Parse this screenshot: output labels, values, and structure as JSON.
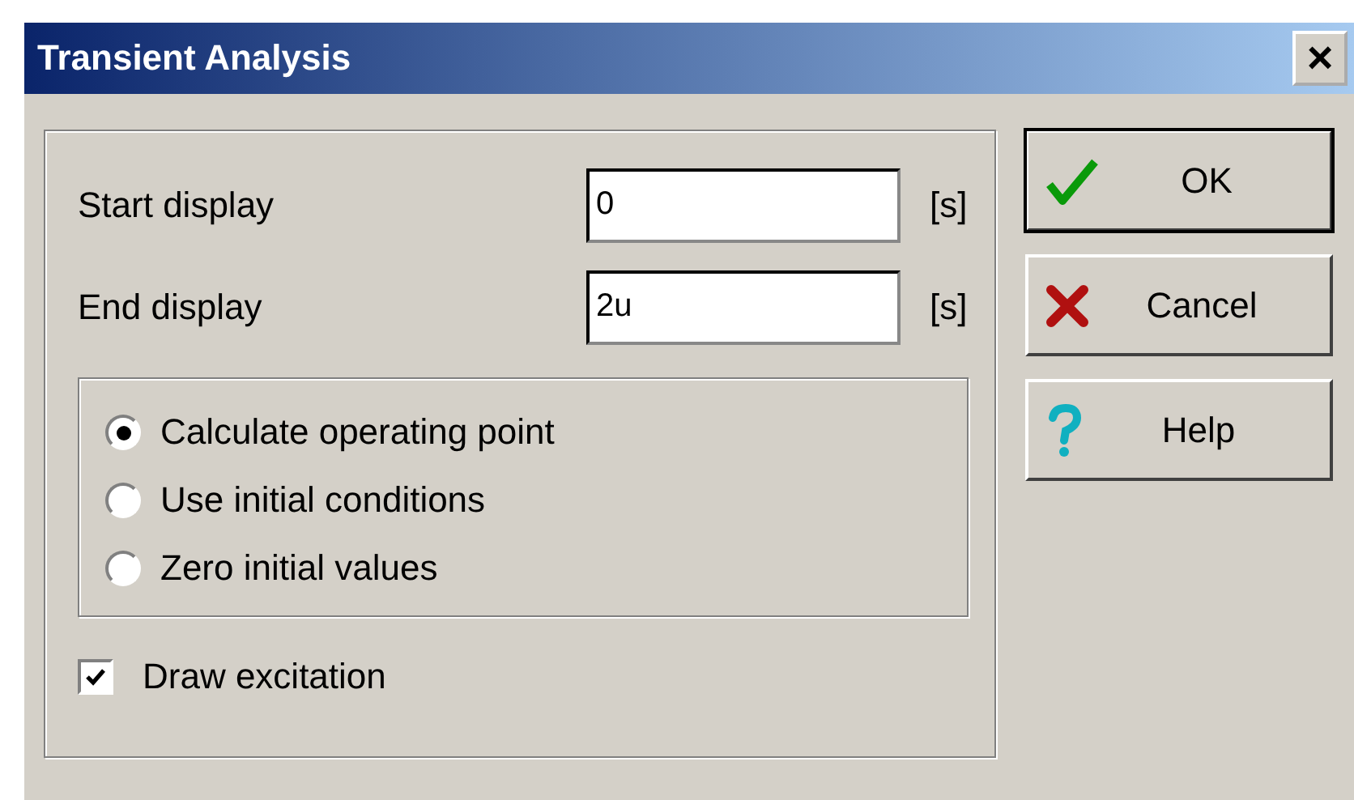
{
  "window": {
    "title": "Transient Analysis",
    "close_glyph": "×"
  },
  "fields": [
    {
      "label": "Start display",
      "value": "0",
      "unit": "[s]"
    },
    {
      "label": "End display",
      "value": "2u",
      "unit": "[s]"
    }
  ],
  "radios": [
    {
      "label": "Calculate operating point",
      "selected": true
    },
    {
      "label": "Use initial conditions",
      "selected": false
    },
    {
      "label": "Zero initial values",
      "selected": false
    }
  ],
  "checkbox": {
    "label": "Draw excitation",
    "checked": true
  },
  "buttons": [
    {
      "kind": "ok",
      "label": "OK",
      "default": true
    },
    {
      "kind": "cancel",
      "label": "Cancel",
      "default": false
    },
    {
      "kind": "help",
      "label": "Help",
      "default": false
    }
  ]
}
